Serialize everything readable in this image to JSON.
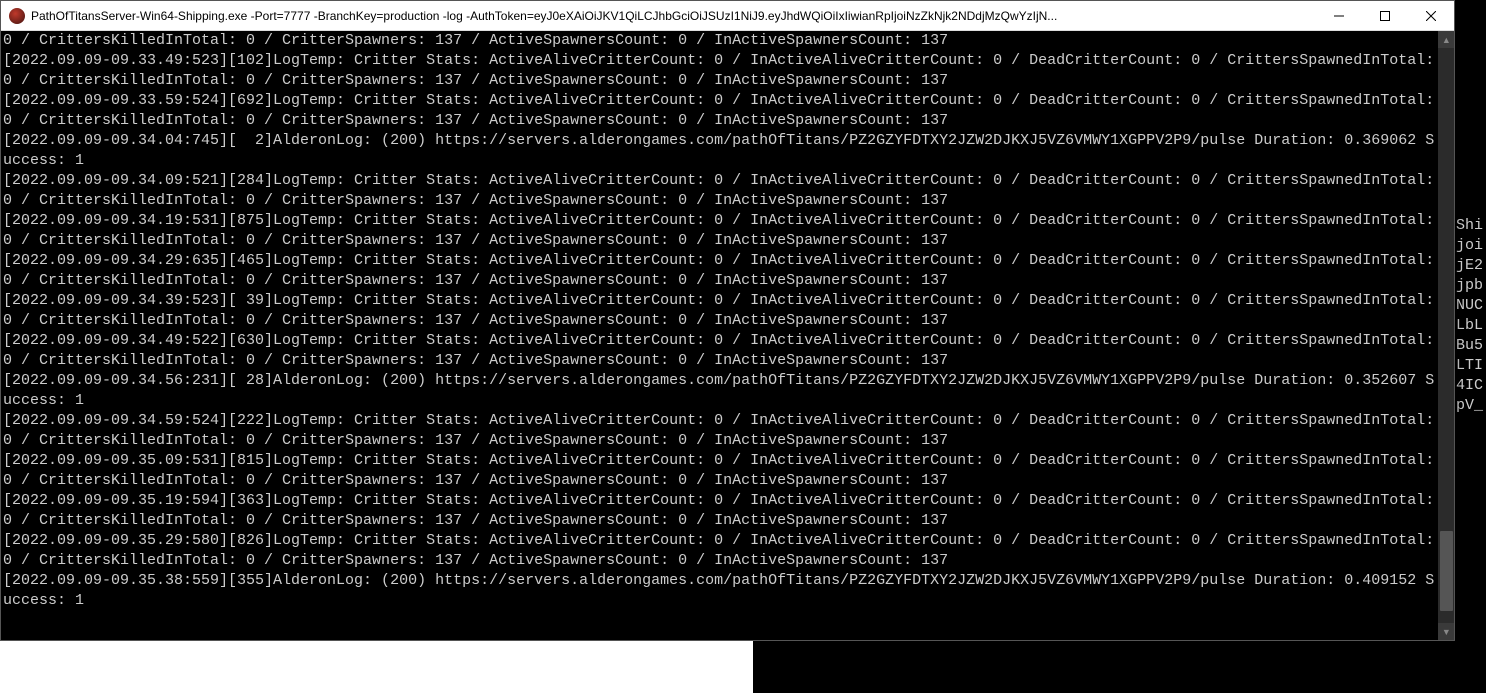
{
  "window": {
    "title": "PathOfTitansServer-Win64-Shipping.exe  -Port=7777 -BranchKey=production -log -AuthToken=eyJ0eXAiOiJKV1QiLCJhbGciOiJSUzI1NiJ9.eyJhdWQiOiIxIiwianRpIjoiNzZkNjk2NDdjMzQwYzIjN..."
  },
  "console": {
    "critter_line2": "0 / CrittersKilledInTotal: 0 / CritterSpawners: 137 / ActiveSpawnersCount: 0 / InActiveSpawnersCount: 137",
    "pulse_url": "https://servers.alderongames.com/pathOfTitans/PZ2GZYFDTXY2JZW2DJKXJ5VZ6VMWY1XGPPV2P9/pulse",
    "entries": [
      {
        "ts": "2022.09.09-09.33.49:523",
        "frame": "102",
        "type": "logtemp"
      },
      {
        "ts": "2022.09.09-09.33.59:524",
        "frame": "692",
        "type": "logtemp"
      },
      {
        "ts": "2022.09.09-09.34.04:745",
        "frame": "  2",
        "type": "alderon",
        "duration": "0.369062"
      },
      {
        "ts": "2022.09.09-09.34.09:521",
        "frame": "284",
        "type": "logtemp"
      },
      {
        "ts": "2022.09.09-09.34.19:531",
        "frame": "875",
        "type": "logtemp"
      },
      {
        "ts": "2022.09.09-09.34.29:635",
        "frame": "465",
        "type": "logtemp"
      },
      {
        "ts": "2022.09.09-09.34.39:523",
        "frame": " 39",
        "type": "logtemp"
      },
      {
        "ts": "2022.09.09-09.34.49:522",
        "frame": "630",
        "type": "logtemp"
      },
      {
        "ts": "2022.09.09-09.34.56:231",
        "frame": " 28",
        "type": "alderon",
        "duration": "0.352607"
      },
      {
        "ts": "2022.09.09-09.34.59:524",
        "frame": "222",
        "type": "logtemp"
      },
      {
        "ts": "2022.09.09-09.35.09:531",
        "frame": "815",
        "type": "logtemp"
      },
      {
        "ts": "2022.09.09-09.35.19:594",
        "frame": "363",
        "type": "logtemp"
      },
      {
        "ts": "2022.09.09-09.35.29:580",
        "frame": "826",
        "type": "logtemp"
      },
      {
        "ts": "2022.09.09-09.35.38:559",
        "frame": "355",
        "type": "alderon",
        "duration": "0.409152"
      }
    ],
    "critter_msg": "LogTemp: Critter Stats: ActiveAliveCritterCount: 0 / InActiveAliveCritterCount: 0 / DeadCritterCount: 0 / CrittersSpawnedInTotal: ",
    "alderon_prefix": "AlderonLog: (200) ",
    "alderon_suffix1": " Duration: ",
    "alderon_suffix2": " Success: 1"
  },
  "bg_window": {
    "lines": [
      "",
      "",
      "",
      "",
      "",
      "",
      "",
      "",
      "",
      "Shi",
      "joi",
      "jE2",
      "jpb",
      "NUC",
      "LbL",
      "Bu5",
      "LTI",
      "4IC",
      "pV_"
    ]
  }
}
